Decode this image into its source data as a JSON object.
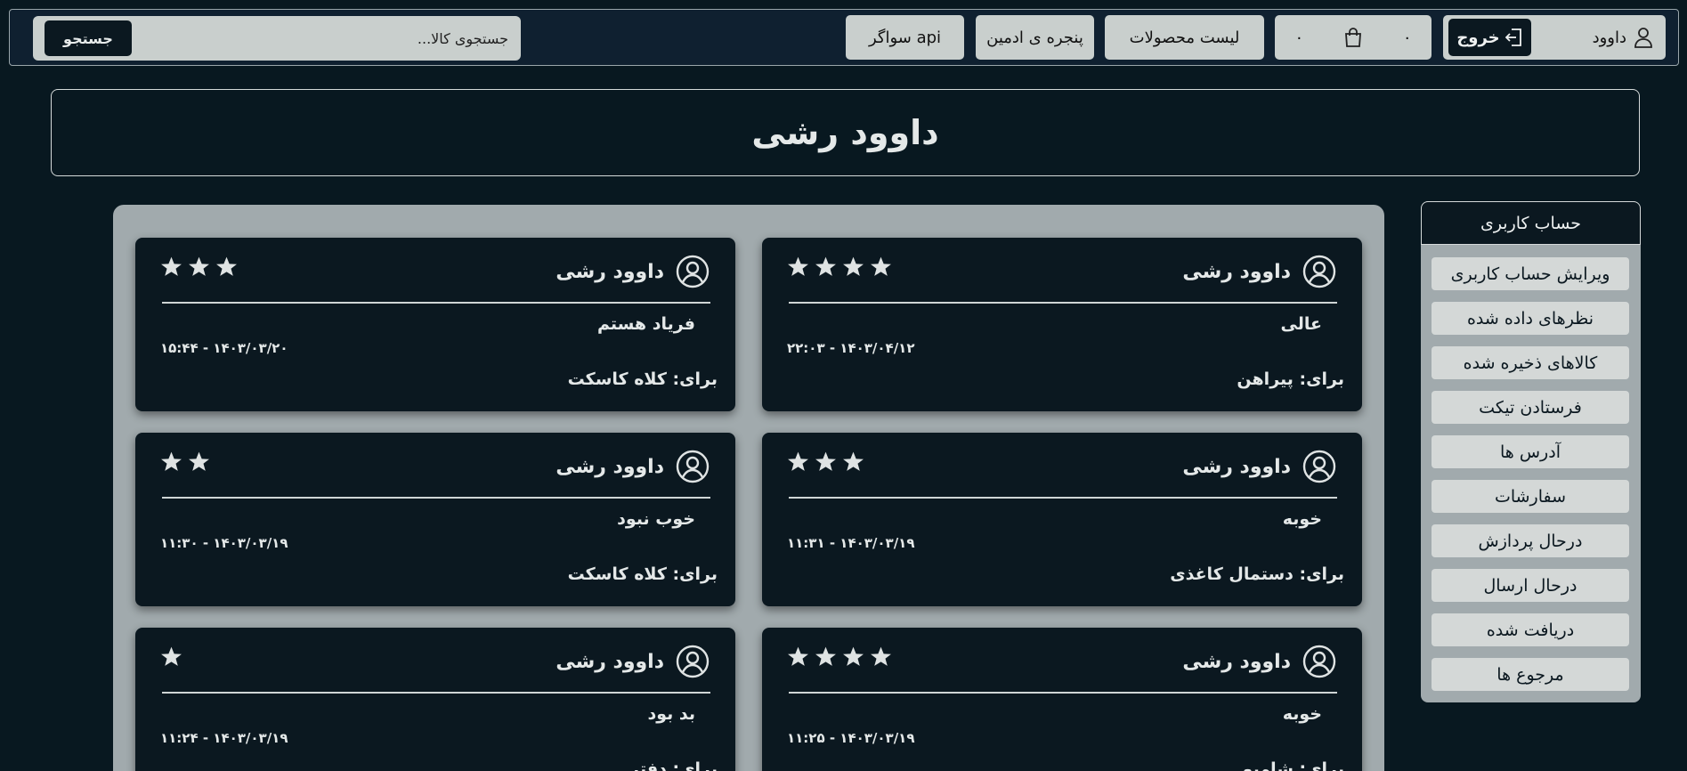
{
  "navbar": {
    "search": {
      "placeholder": "جستجوی کالا...",
      "button_label": "جستجو"
    },
    "swagger_label": "سواگر api",
    "admin_label": "پنجره ی ادمین",
    "products_label": "لیست محصولات",
    "cart": {
      "count_left": "۰",
      "count_right": "۰"
    },
    "user": {
      "name": "داوود",
      "logout_label": "خروج"
    }
  },
  "page": {
    "title": "داوود رشی"
  },
  "sidebar": {
    "header": "حساب کاربری",
    "items": [
      {
        "label": "ویرایش حساب کاربری"
      },
      {
        "label": "نظرهای داده شده"
      },
      {
        "label": "کالاهای ذخیره شده"
      },
      {
        "label": "فرستادن تیکت"
      },
      {
        "label": "آدرس ها"
      },
      {
        "label": "سفارشات"
      },
      {
        "label": "درحال پردازش"
      },
      {
        "label": "درحال ارسال"
      },
      {
        "label": "دریافت شده"
      },
      {
        "label": "مرجوع ها"
      }
    ]
  },
  "comments": [
    {
      "author": "داوود رشی",
      "stars": 4,
      "text": "عالی",
      "date": "۲۲:۰۳ - ۱۴۰۳/۰۴/۱۲",
      "for": "برای: پیراهن"
    },
    {
      "author": "داوود رشی",
      "stars": 3,
      "text": "فریاد هستم",
      "date": "۱۵:۴۴ - ۱۴۰۳/۰۳/۲۰",
      "for": "برای: کلاه کاسکت"
    },
    {
      "author": "داوود رشی",
      "stars": 3,
      "text": "خوبه",
      "date": "۱۱:۳۱ - ۱۴۰۳/۰۳/۱۹",
      "for": "برای: دستمال کاغذی"
    },
    {
      "author": "داوود رشی",
      "stars": 2,
      "text": "خوب نبود",
      "date": "۱۱:۳۰ - ۱۴۰۳/۰۳/۱۹",
      "for": "برای: کلاه کاسکت"
    },
    {
      "author": "داوود رشی",
      "stars": 4,
      "text": "خوبه",
      "date": "۱۱:۲۵ - ۱۴۰۳/۰۳/۱۹",
      "for": "برای: شامپو"
    },
    {
      "author": "داوود رشی",
      "stars": 1,
      "text": "بد بود",
      "date": "۱۱:۲۴ - ۱۴۰۳/۰۳/۱۹",
      "for": "برای: دفتر"
    }
  ]
}
